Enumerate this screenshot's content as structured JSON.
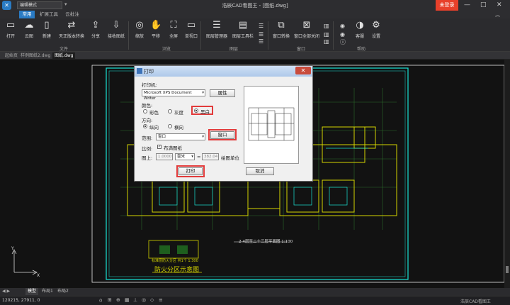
{
  "app": {
    "logo_glyph": "✕",
    "mode_value": "编辑模式",
    "window_title": "浩辰CAD看图王 - [图纸.dwg]",
    "login_label": "未登录",
    "win_minimize": "—",
    "win_maximize": "□",
    "win_close": "✕"
  },
  "ribbon_tabs": [
    {
      "label": "常用",
      "active": true
    },
    {
      "label": "扩展工具",
      "active": false
    },
    {
      "label": "云批注",
      "active": false
    }
  ],
  "ribbon_toggle": "︽",
  "ribbon": {
    "buttons": [
      {
        "label": "打开",
        "icon": "folder-open-icon",
        "glyph": "📂"
      },
      {
        "label": "云图",
        "icon": "cloud-icon",
        "glyph": "☁"
      },
      {
        "label": "新建",
        "icon": "new-file-icon",
        "glyph": "🗎"
      },
      {
        "label": "天正版本转换",
        "icon": "convert-icon",
        "glyph": "⇄"
      },
      {
        "label": "分享",
        "icon": "share-icon",
        "glyph": "⇪"
      },
      {
        "label": "接收图纸",
        "icon": "receive-icon",
        "glyph": "⇩"
      },
      {
        "label": "缩放",
        "icon": "zoom-icon",
        "glyph": "🔍"
      },
      {
        "label": "平移",
        "icon": "pan-icon",
        "glyph": "✋"
      },
      {
        "label": "全屏",
        "icon": "fullscreen-icon",
        "glyph": "⛶"
      },
      {
        "label": "单视口",
        "icon": "single-viewport-icon",
        "glyph": "▭"
      },
      {
        "label": "图层管理器",
        "icon": "layer-manager-icon",
        "glyph": "☰"
      },
      {
        "label": "图层工具栏",
        "icon": "layer-toolbar-icon",
        "glyph": "▤"
      },
      {
        "label": "窗口转换",
        "icon": "window-switch-icon",
        "glyph": "⧉"
      },
      {
        "label": "窗口全部关闭",
        "icon": "close-all-windows-icon",
        "glyph": "⊠"
      },
      {
        "label": "客服",
        "icon": "customer-service-icon",
        "glyph": "🎧"
      },
      {
        "label": "设置",
        "icon": "settings-icon",
        "glyph": "⚙"
      }
    ],
    "groups": [
      {
        "label": "文件"
      },
      {
        "label": "浏览"
      },
      {
        "label": "图层"
      },
      {
        "label": "窗口"
      },
      {
        "label": "帮助"
      }
    ]
  },
  "doc_tabs": [
    {
      "label": "起始页",
      "active": false
    },
    {
      "label": "样例图纸2.dwg",
      "active": false
    },
    {
      "label": "图纸.dwg",
      "active": true
    }
  ],
  "dialog": {
    "title": "打印",
    "printer_label": "打印机:",
    "printer_value": "Microsoft XPS Document Writer",
    "properties_button": "属性",
    "color_label": "颜色:",
    "color_options": [
      "彩色",
      "灰度",
      "黑白"
    ],
    "color_selected": "黑白",
    "direction_label": "方向:",
    "direction_options": [
      "纵向",
      "横向"
    ],
    "direction_selected": "纵向",
    "range_label": "范围:",
    "range_value": "窗口",
    "window_button": "窗口",
    "scale_label": "比例:",
    "fit_label": "布满图纸",
    "fit_checked": true,
    "paper_label": "图上:",
    "paper_value": "1.0000",
    "unit_value": "毫米",
    "equals": "=",
    "drawing_value": "382.04",
    "drawing_unit_label": "绘图单位",
    "print_button": "打印",
    "cancel_button": "取消"
  },
  "drawing": {
    "plan_title": "2-4层至二十三层平面图",
    "plan_scale": "1:100",
    "fire_zone_title": "防火分区示意图",
    "fire_zone_subtitle": "标准层防火分区 共1个 1:300"
  },
  "layout_tabs": [
    {
      "label": "模型",
      "active": true
    },
    {
      "label": "布局1",
      "active": false
    },
    {
      "label": "布局2",
      "active": false
    }
  ],
  "status": {
    "coords": "120215, 27911, 0",
    "right_text": "浩辰CAD看图王"
  },
  "colors": {
    "accent": "#2a7bc4",
    "login": "#e8402a",
    "highlight": "#e23b3b",
    "frame": "#19e3d6",
    "wall": "#d4d400",
    "grid": "#2a6a2a"
  }
}
